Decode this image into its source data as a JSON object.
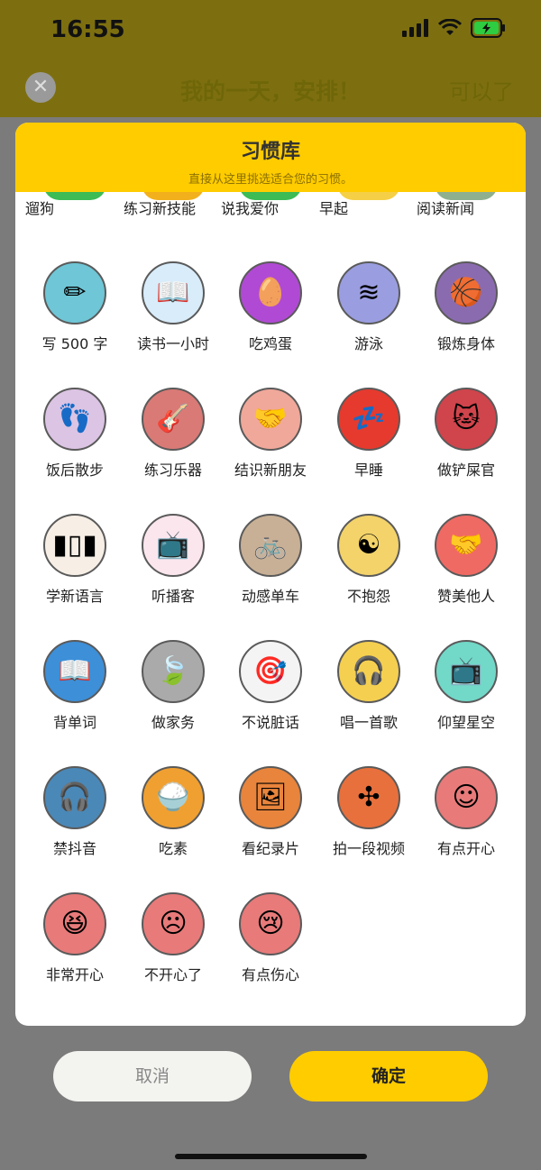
{
  "status": {
    "time": "16:55"
  },
  "background": {
    "close_glyph": "✕",
    "title": "我的一天，安排！",
    "right_action": "可以了"
  },
  "sheet": {
    "title": "习惯库",
    "subtitle": "直接从这里挑选适合您的习惯。",
    "top_row": [
      {
        "label": "遛狗",
        "color": "#3dbb55"
      },
      {
        "label": "练习新技能",
        "color": "#f2b01c"
      },
      {
        "label": "说我爱你",
        "color": "#3dbb55"
      },
      {
        "label": "早起",
        "color": "#f5cf45"
      },
      {
        "label": "阅读新闻",
        "color": "#8fb08f"
      }
    ],
    "habits": [
      {
        "label": "写 500 字",
        "color": "#6ec6d6",
        "icon": "pencil-icon",
        "glyph": "✏"
      },
      {
        "label": "读书一小时",
        "color": "#d8ecfa",
        "icon": "book-icon",
        "glyph": "📖"
      },
      {
        "label": "吃鸡蛋",
        "color": "#b04ad4",
        "icon": "egg-icon",
        "glyph": "🥚"
      },
      {
        "label": "游泳",
        "color": "#9a9ee0",
        "icon": "pool-icon",
        "glyph": "≋"
      },
      {
        "label": "锻炼身体",
        "color": "#8b6bb0",
        "icon": "basketball-icon",
        "glyph": "🏀"
      },
      {
        "label": "饭后散步",
        "color": "#dcc4e4",
        "icon": "footprint-icon",
        "glyph": "👣"
      },
      {
        "label": "练习乐器",
        "color": "#d97a76",
        "icon": "guitar-icon",
        "glyph": "🎸"
      },
      {
        "label": "结识新朋友",
        "color": "#f0a89a",
        "icon": "handshake-icon",
        "glyph": "🤝"
      },
      {
        "label": "早睡",
        "color": "#e63a2e",
        "icon": "sleep-icon",
        "glyph": "💤"
      },
      {
        "label": "做铲屎官",
        "color": "#d0444c",
        "icon": "cat-icon",
        "glyph": "🐱"
      },
      {
        "label": "学新语言",
        "color": "#f7efe6",
        "icon": "flag-icon",
        "glyph": "▮▯▮"
      },
      {
        "label": "听播客",
        "color": "#fbe6ee",
        "icon": "tv-icon",
        "glyph": "📺"
      },
      {
        "label": "动感单车",
        "color": "#c8b096",
        "icon": "bike-icon",
        "glyph": "🚲"
      },
      {
        "label": "不抱怨",
        "color": "#f3d36a",
        "icon": "yinyang-icon",
        "glyph": "☯"
      },
      {
        "label": "赞美他人",
        "color": "#f06a64",
        "icon": "handshake-icon",
        "glyph": "🤝"
      },
      {
        "label": "背单词",
        "color": "#3d8fd8",
        "icon": "book-icon",
        "glyph": "📖"
      },
      {
        "label": "做家务",
        "color": "#aaaaaa",
        "icon": "leaf-icon",
        "glyph": "🍃"
      },
      {
        "label": "不说脏话",
        "color": "#f4f4f4",
        "icon": "target-icon",
        "glyph": "🎯"
      },
      {
        "label": "唱一首歌",
        "color": "#f5cf50",
        "icon": "headphones-icon",
        "glyph": "🎧"
      },
      {
        "label": "仰望星空",
        "color": "#72d8c8",
        "icon": "tv-icon",
        "glyph": "📺"
      },
      {
        "label": "禁抖音",
        "color": "#4a88b8",
        "icon": "headphones-icon",
        "glyph": "🎧"
      },
      {
        "label": "吃素",
        "color": "#f0a030",
        "icon": "rice-bowl-icon",
        "glyph": "🍚"
      },
      {
        "label": "看纪录片",
        "color": "#e8843c",
        "icon": "stamp-icon",
        "glyph": "🖼"
      },
      {
        "label": "拍一段视频",
        "color": "#e8703c",
        "icon": "pinwheel-icon",
        "glyph": "✣"
      },
      {
        "label": "有点开心",
        "color": "#e87a7a",
        "icon": "smile-icon",
        "glyph": "☺"
      },
      {
        "label": "非常开心",
        "color": "#e87a7a",
        "icon": "laugh-icon",
        "glyph": "😆"
      },
      {
        "label": "不开心了",
        "color": "#e87a7a",
        "icon": "sad-icon",
        "glyph": "☹"
      },
      {
        "label": "有点伤心",
        "color": "#e87a7a",
        "icon": "cry-icon",
        "glyph": "😢"
      }
    ]
  },
  "buttons": {
    "cancel": "取消",
    "confirm": "确定"
  }
}
